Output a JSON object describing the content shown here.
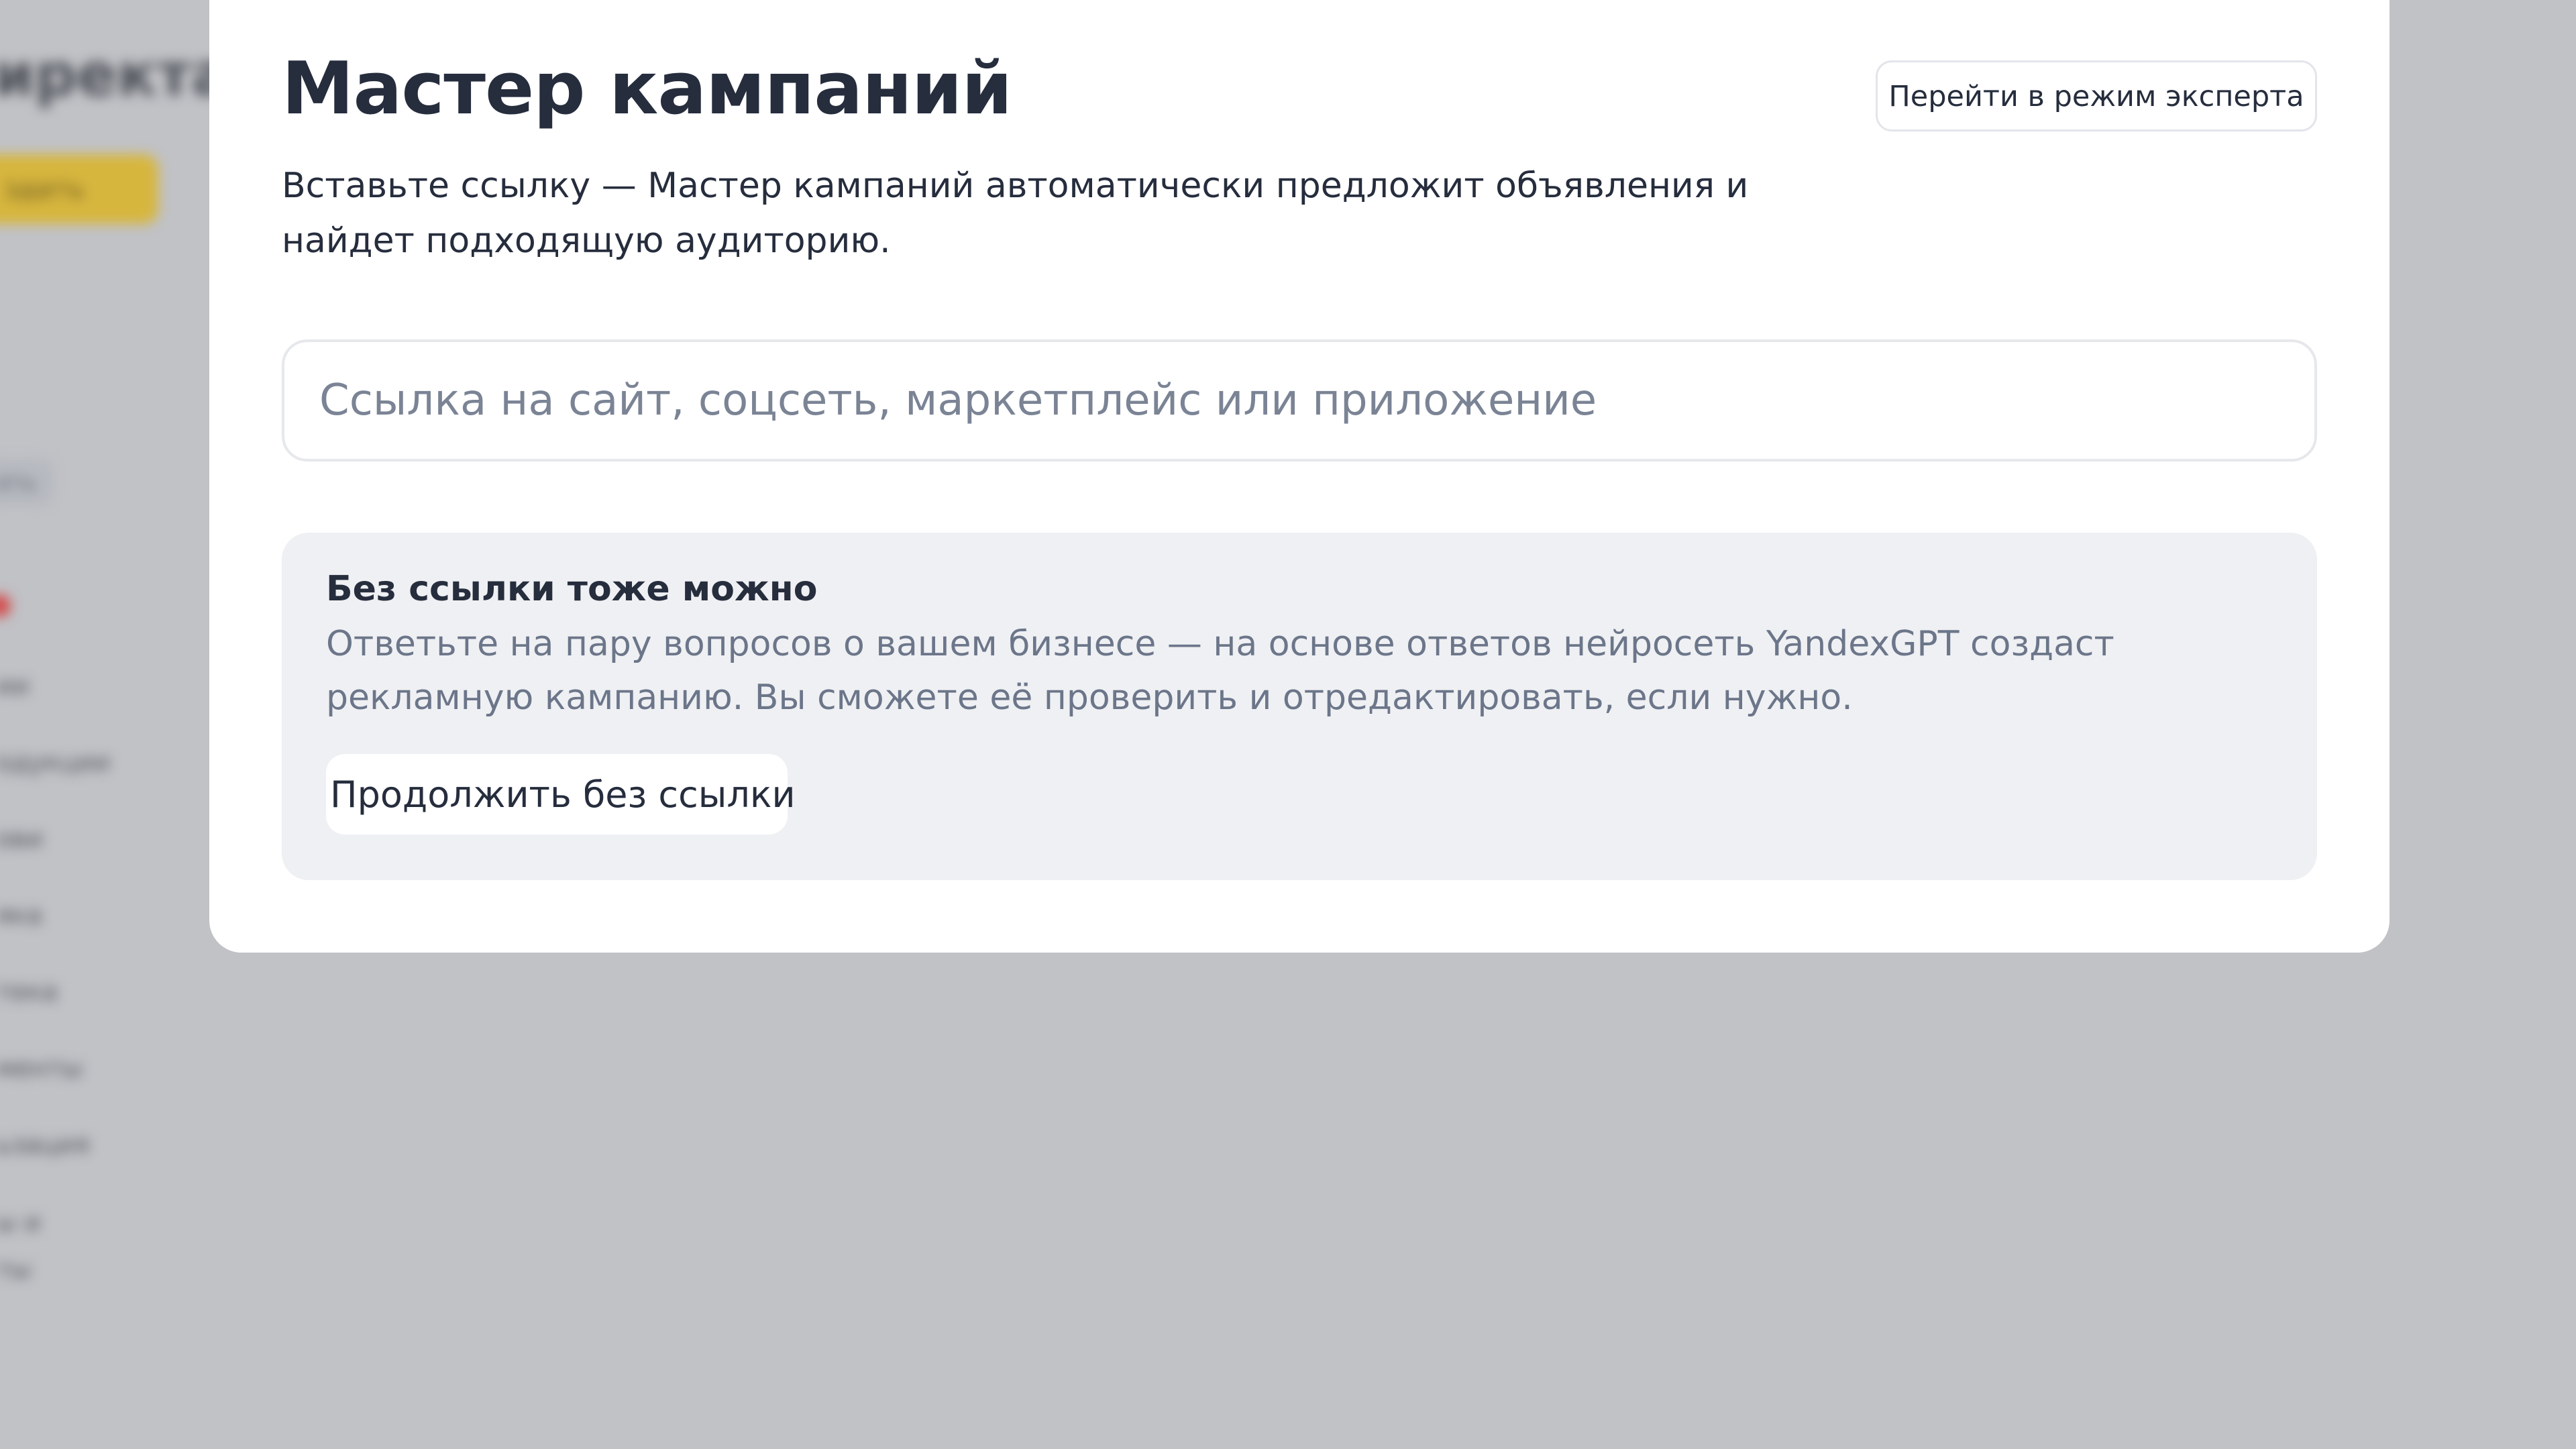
{
  "modal": {
    "title": "Мастер кампаний",
    "expert_mode_button": "Перейти в режим эксперта",
    "description": "Вставьте ссылку — Мастер кампаний автоматически предложит объявления и найдет подходящую аудиторию.",
    "link_input": {
      "value": "",
      "placeholder": "Ссылка на сайт, соцсеть, маркетплейс или приложение"
    },
    "no_link_card": {
      "title": "Без ссылки тоже можно",
      "text": "Ответьте на пару вопросов о вашем бизнесе — на основе ответов нейросеть YandexGPT создаст рекламную кампанию. Вы сможете её проверить и отредактировать, если нужно.",
      "continue_button": "Продолжить без ссылки"
    }
  },
  "background": {
    "brand": "иректа",
    "create_button": "здать",
    "chip": "ать",
    "nav_items": [
      "ии",
      "одукции",
      "ови",
      "яка",
      "тека",
      "менты",
      "ьзация",
      "ы и",
      "ты"
    ]
  },
  "colors": {
    "overlay": "#c3c4c8",
    "title_text": "#262d3d",
    "secondary_text": "#6c768a",
    "card_background": "#eff0f3",
    "brand_yellow": "#d7b63e"
  }
}
